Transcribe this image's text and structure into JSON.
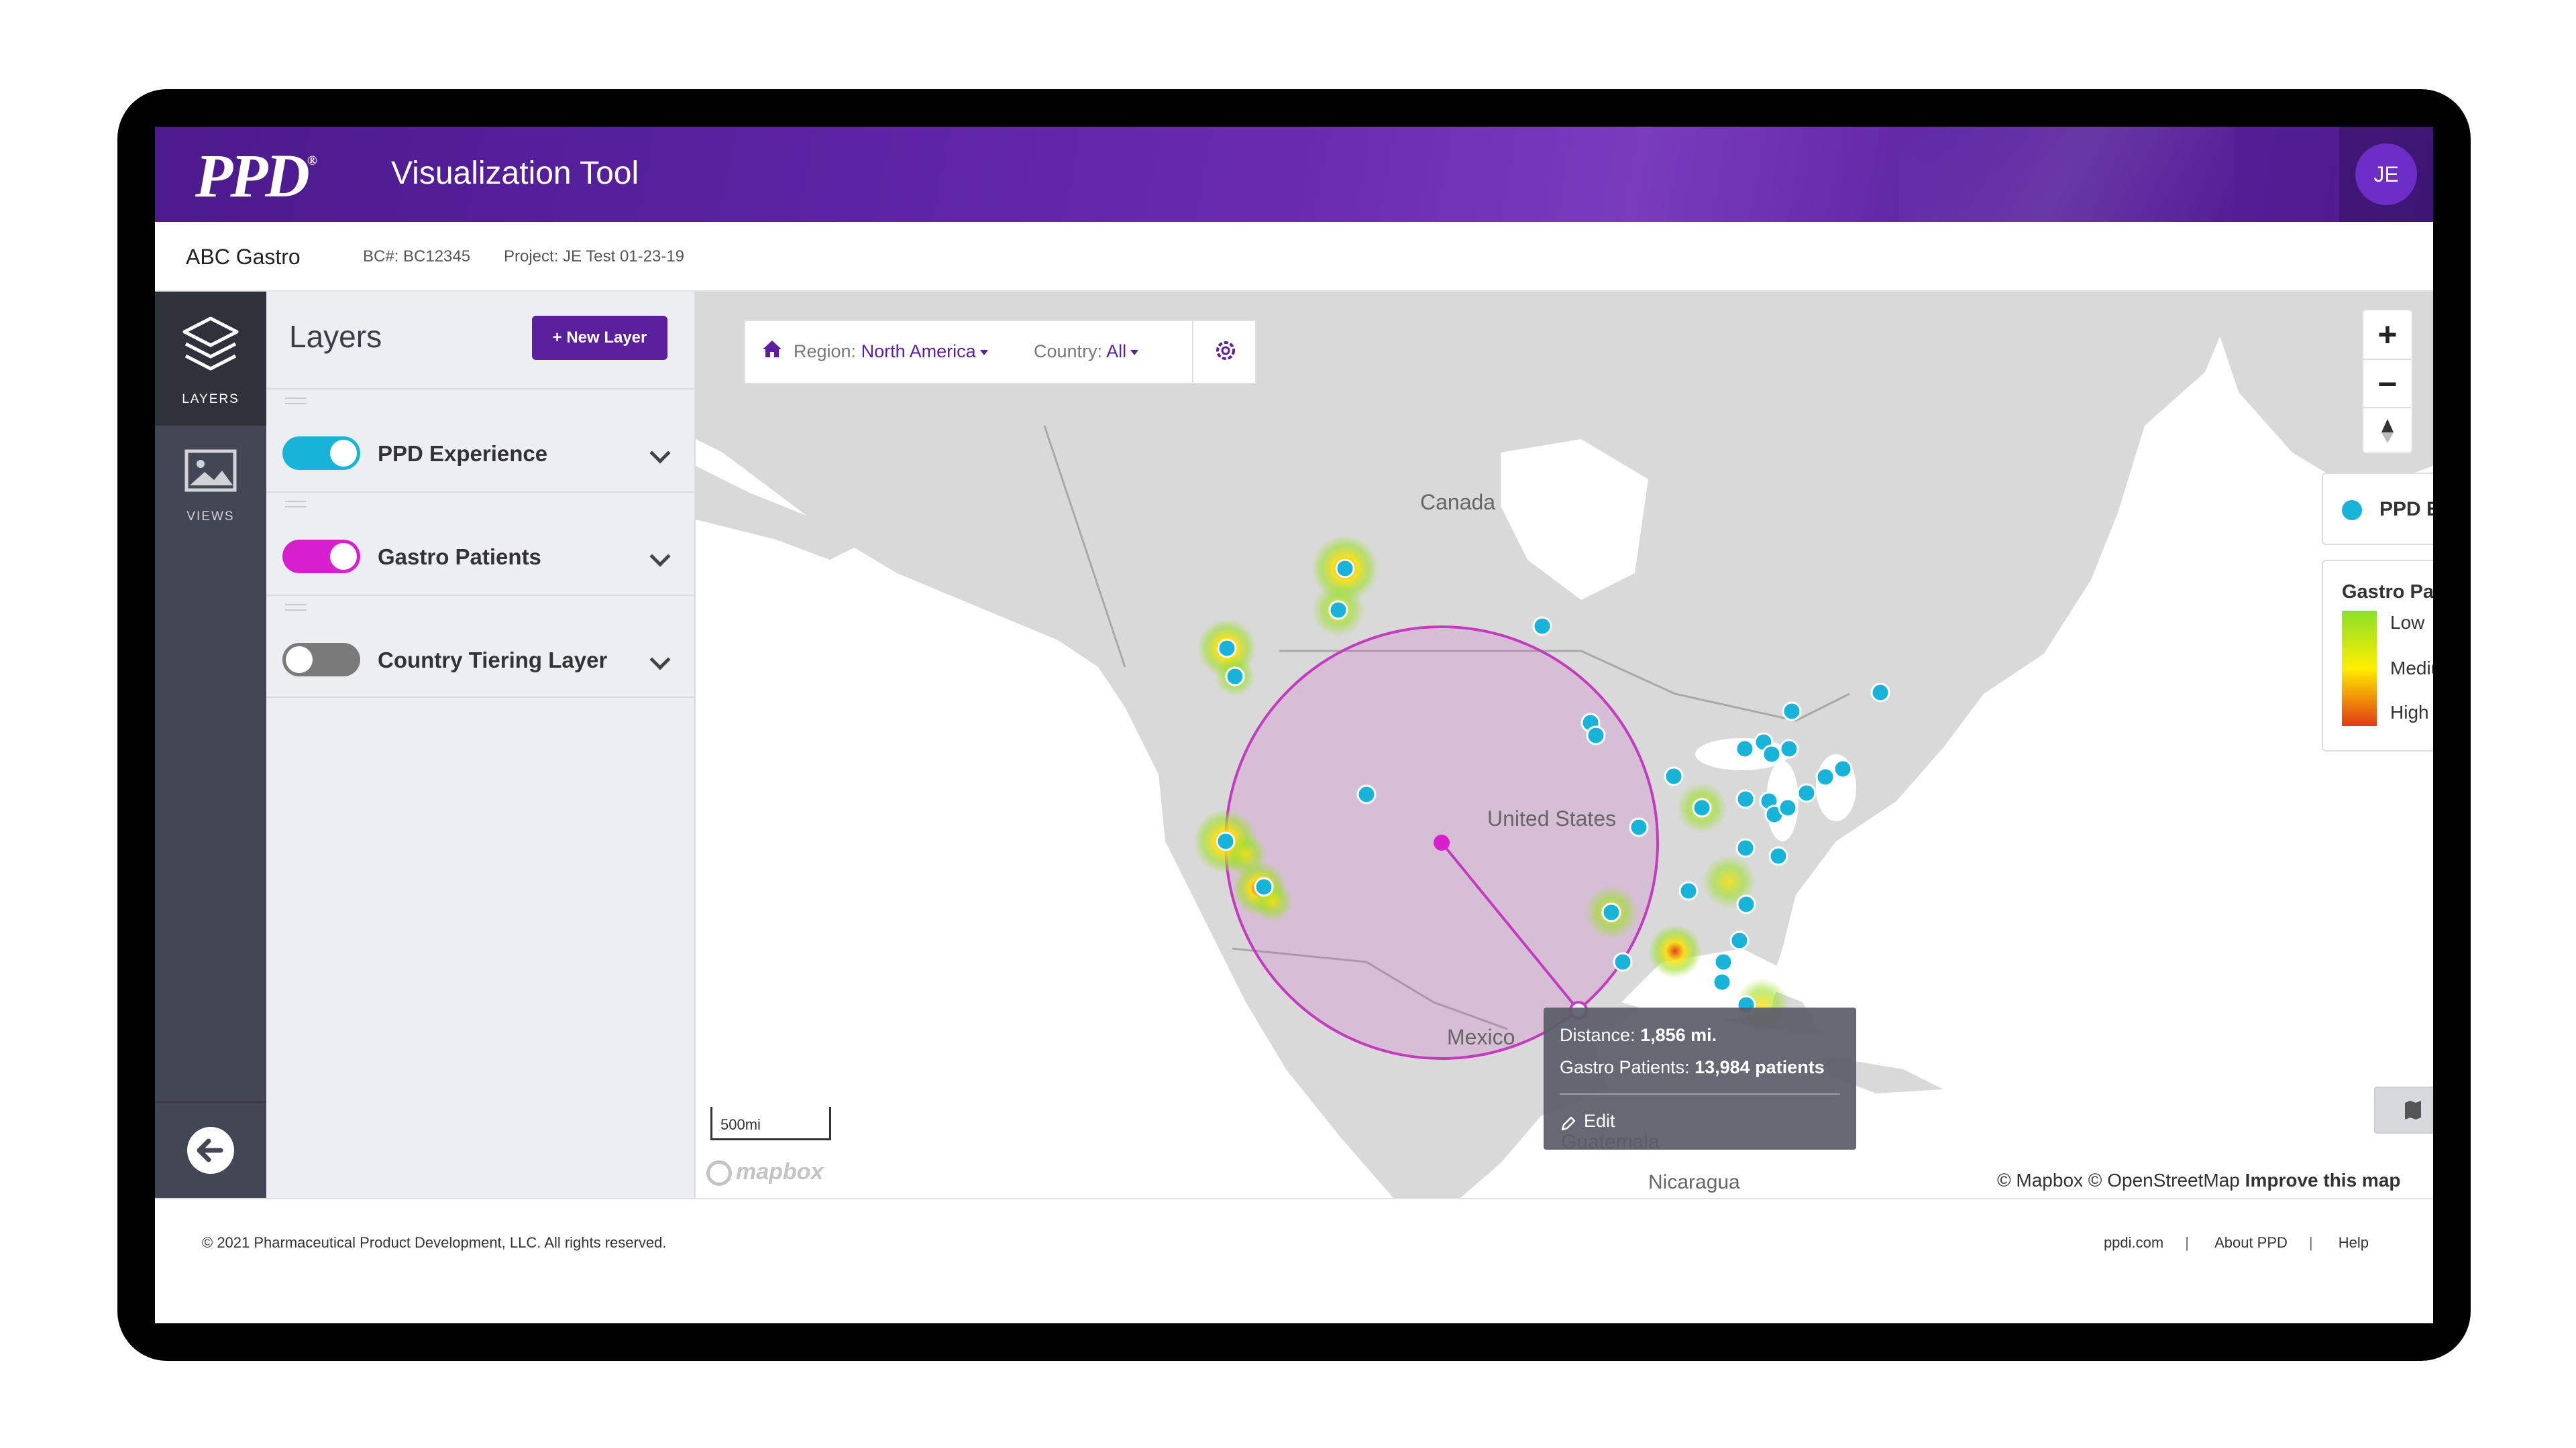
{
  "header": {
    "logo": "PPD",
    "title": "Visualization Tool",
    "user_initials": "JE"
  },
  "project": {
    "name": "ABC Gastro",
    "bc": "BC#: BC12345",
    "project": "Project: JE Test 01-23-19"
  },
  "rail": {
    "layers_label": "LAYERS",
    "views_label": "VIEWS"
  },
  "panel": {
    "title": "Layers",
    "new_layer_label": "New Layer",
    "layers": [
      {
        "name": "PPD Experience",
        "enabled": true,
        "color": "#17b3d8"
      },
      {
        "name": "Gastro Patients",
        "enabled": true,
        "color": "#d81fd0"
      },
      {
        "name": "Country Tiering Layer",
        "enabled": false,
        "color": "#7a7a7a"
      }
    ]
  },
  "filters": {
    "region_label": "Region:",
    "region_value": "North America",
    "country_label": "Country:",
    "country_value": "All"
  },
  "map_labels": {
    "canada": "Canada",
    "us": "United States",
    "mexico": "Mexico",
    "guatemala": "Guatemala",
    "nicaragua": "Nicaragua"
  },
  "legend": {
    "ppd": "PPD Experience",
    "gastro_title": "Gastro Patients",
    "low": "Low",
    "medium": "Medium",
    "high": "High"
  },
  "tooltip": {
    "distance_label": "Distance:",
    "distance_value": "1,856 mi.",
    "patients_label": "Gastro Patients:",
    "patients_value": "13,984 patients",
    "edit_label": "Edit"
  },
  "scale_label": "500mi",
  "mapbox_label": "mapbox",
  "attribution": {
    "text": "© Mapbox © OpenStreetMap",
    "improve": "Improve this map"
  },
  "footer": {
    "copyright": "© 2021 Pharmaceutical Product Development, LLC. All rights reserved.",
    "links": [
      "ppdi.com",
      "About PPD",
      "Help"
    ]
  },
  "colors": {
    "brand_purple": "#5a1f9c",
    "ppd_dot": "#17b3d8",
    "gastro_pink": "#d81fd0",
    "land": "#d9d9d9"
  }
}
